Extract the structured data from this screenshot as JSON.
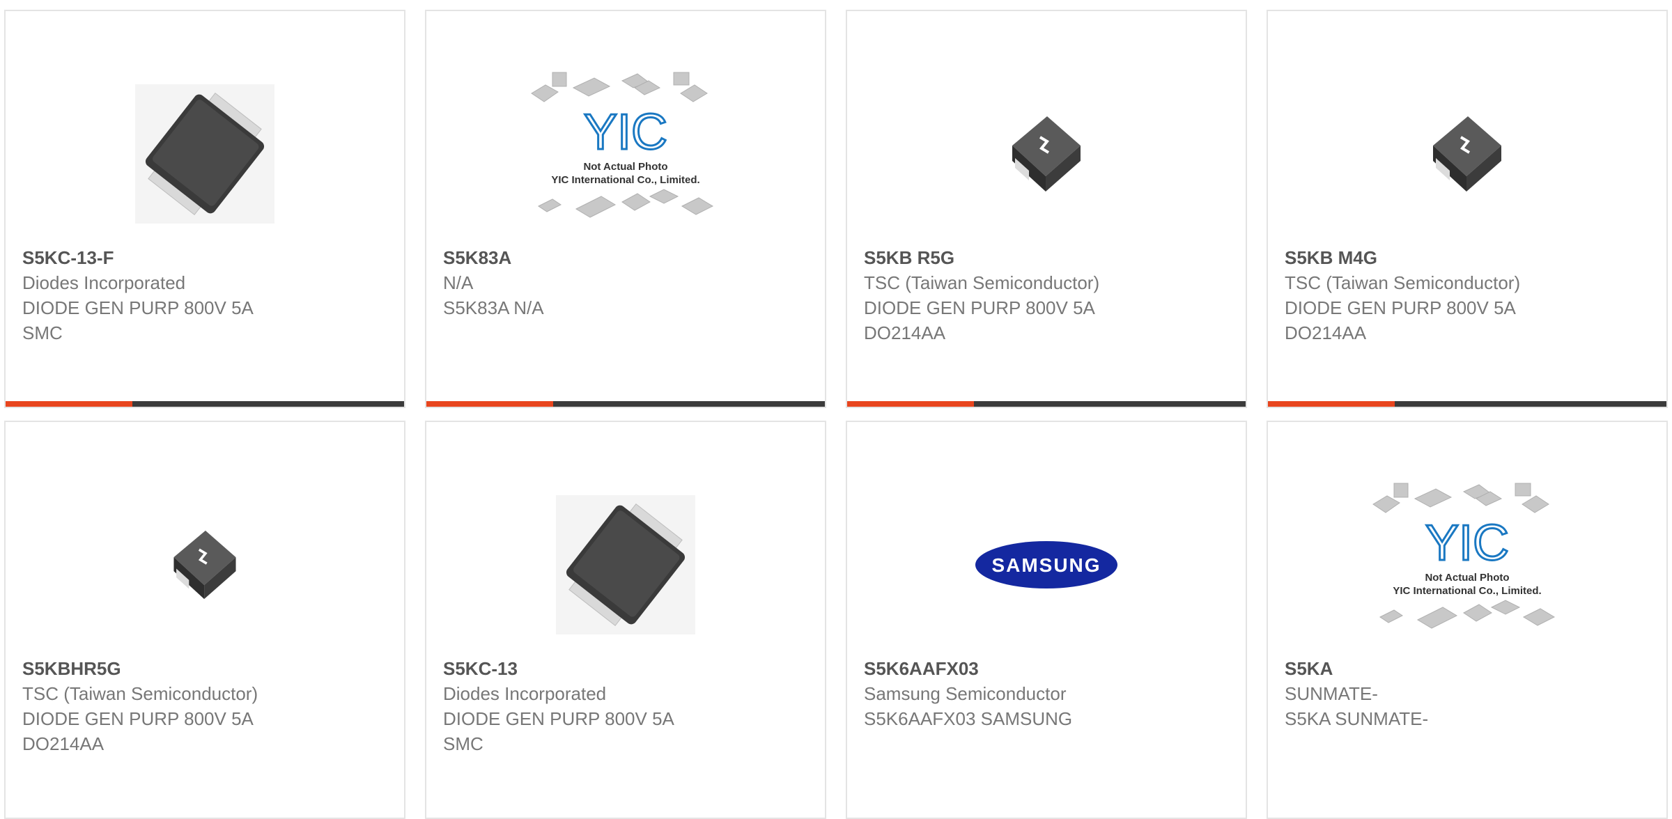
{
  "colors": {
    "accent": "#e8451e",
    "bar": "#3b3b3b",
    "border": "#e4e4e4",
    "title_text": "#555555",
    "body_text": "#777777",
    "samsung_blue": "#1428a0",
    "yic_blue": "#1a78c2"
  },
  "cards": [
    {
      "part_number": "S5KC-13-F",
      "line1": "Diodes Incorporated",
      "line2": "DIODE GEN PURP 800V 5A",
      "line3": "SMC",
      "image": "smc-diode-package-photo"
    },
    {
      "part_number": "S5K83A",
      "line1": "N/A",
      "line2": "S5K83A N/A",
      "line3": "",
      "image": "yic-not-actual-photo-placeholder",
      "placeholder_title": "Not Actual Photo",
      "placeholder_company": "YIC International Co., Limited.",
      "placeholder_logo": "YIC"
    },
    {
      "part_number": "S5KB R5G",
      "line1": "TSC (Taiwan Semiconductor)",
      "line2": "DIODE GEN PURP 800V 5A",
      "line3": "DO214AA",
      "image": "tsc-do214aa-package-photo"
    },
    {
      "part_number": "S5KB M4G",
      "line1": "TSC (Taiwan Semiconductor)",
      "line2": "DIODE GEN PURP 800V 5A",
      "line3": "DO214AA",
      "image": "tsc-do214aa-package-photo"
    },
    {
      "part_number": "S5KBHR5G",
      "line1": "TSC (Taiwan Semiconductor)",
      "line2": "DIODE GEN PURP 800V 5A",
      "line3": "DO214AA",
      "image": "tsc-do214aa-package-photo"
    },
    {
      "part_number": "S5KC-13",
      "line1": "Diodes Incorporated",
      "line2": "DIODE GEN PURP 800V 5A",
      "line3": "SMC",
      "image": "smc-diode-package-photo"
    },
    {
      "part_number": "S5K6AAFX03",
      "line1": "Samsung Semiconductor",
      "line2": "S5K6AAFX03 SAMSUNG",
      "line3": "",
      "image": "samsung-logo",
      "logo_text": "SAMSUNG"
    },
    {
      "part_number": "S5KA",
      "line1": "SUNMATE-",
      "line2": "S5KA SUNMATE-",
      "line3": "",
      "image": "yic-not-actual-photo-placeholder",
      "placeholder_title": "Not Actual Photo",
      "placeholder_company": "YIC International Co., Limited.",
      "placeholder_logo": "YIC"
    }
  ]
}
